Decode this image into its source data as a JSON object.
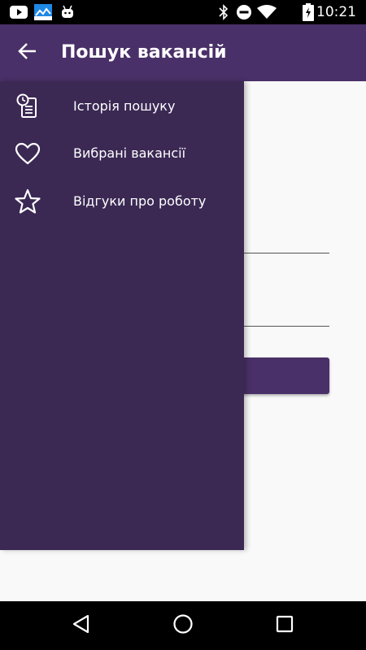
{
  "status_bar": {
    "time": "10:21",
    "left_icons": [
      "youtube-icon",
      "photo-app-icon",
      "android-icon"
    ],
    "right_icons": [
      "bluetooth-icon",
      "do-not-disturb-icon",
      "wifi-icon",
      "battery-icon"
    ]
  },
  "app_bar": {
    "title": "Пошук вакансій",
    "back_icon": "arrow-left-icon",
    "color": "#4a3068"
  },
  "drawer": {
    "color": "#3b2954",
    "items": [
      {
        "label": "Історія пошуку",
        "icon": "history-icon"
      },
      {
        "label": "Вибрані вакансії",
        "icon": "heart-icon"
      },
      {
        "label": "Відгуки про роботу",
        "icon": "star-icon"
      }
    ]
  },
  "nav_bar": {
    "buttons": [
      "back-triangle-icon",
      "home-circle-icon",
      "recents-square-icon"
    ]
  }
}
